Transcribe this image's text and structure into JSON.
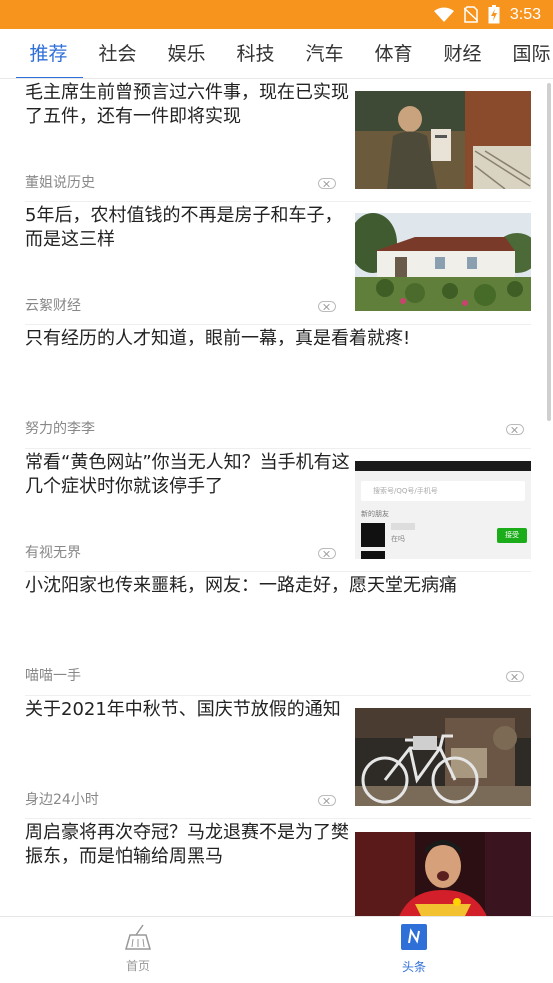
{
  "status_bar": {
    "time": "3:53",
    "icons": [
      "wifi-icon",
      "no-sim-icon",
      "battery-charging-icon"
    ]
  },
  "tabs": [
    {
      "label": "推荐",
      "active": true
    },
    {
      "label": "社会"
    },
    {
      "label": "娱乐"
    },
    {
      "label": "科技"
    },
    {
      "label": "汽车"
    },
    {
      "label": "体育"
    },
    {
      "label": "财经"
    },
    {
      "label": "国际"
    }
  ],
  "feed": [
    {
      "title": "毛主席生前曾预言过六件事，现在已实现了五件，还有一件即将实现",
      "source": "董姐说历史",
      "has_image": true,
      "image": "historical-photo"
    },
    {
      "title": "5年后，农村值钱的不再是房子和车子，而是这三样",
      "source": "云絮财经",
      "has_image": true,
      "image": "rural-house-photo"
    },
    {
      "title": "只有经历的人才知道，眼前一幕，真是看着就疼!",
      "source": "努力的李李",
      "has_image": false
    },
    {
      "title": "常看“黄色网站”你当无人知？当手机有这几个症状时你就该停手了",
      "source": "有视无界",
      "has_image": true,
      "image": "phone-screenshot"
    },
    {
      "title": "小沈阳家也传来噩耗，网友：一路走好，愿天堂无病痛",
      "source": "喵喵一手",
      "has_image": false
    },
    {
      "title": "关于2021年中秋节、国庆节放假的通知",
      "source": "身边24小时",
      "has_image": true,
      "image": "bicycle-photo"
    },
    {
      "title": "周启豪将再次夺冠？马龙退赛不是为了樊振东，而是怕输给周黑马",
      "source": "",
      "has_image": true,
      "image": "athlete-photo"
    }
  ],
  "phone_screenshot": {
    "search_placeholder": "搜索号/QQ号/手机号",
    "section": "新的朋友",
    "button": "接受",
    "contact_note": "在吗"
  },
  "bottom_nav": [
    {
      "label": "首页",
      "icon": "broom-icon",
      "active": false
    },
    {
      "label": "头条",
      "icon": "news-n-icon",
      "active": true
    }
  ],
  "colors": {
    "status_bar": "#f7941e",
    "accent": "#2f6fd8"
  }
}
